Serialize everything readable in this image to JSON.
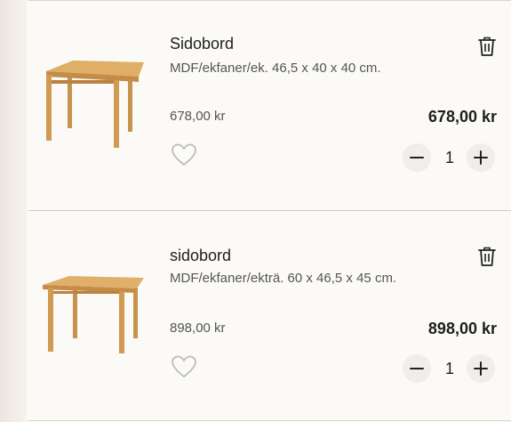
{
  "cart": {
    "items": [
      {
        "title": "Sidobord",
        "description": "MDF/ekfaner/ek. 46,5 x 40 x 40 cm.",
        "unit_price": "678,00 kr",
        "total_price": "678,00 kr",
        "quantity": "1",
        "wood_color": "#d7a35a"
      },
      {
        "title": "sidobord",
        "description": "MDF/ekfaner/ekträ. 60 x 46,5 x 45 cm.",
        "unit_price": "898,00 kr",
        "total_price": "898,00 kr",
        "quantity": "1",
        "wood_color": "#d9a35a"
      }
    ],
    "icons": [
      "trash-icon",
      "heart-icon",
      "minus-icon",
      "plus-icon"
    ]
  }
}
